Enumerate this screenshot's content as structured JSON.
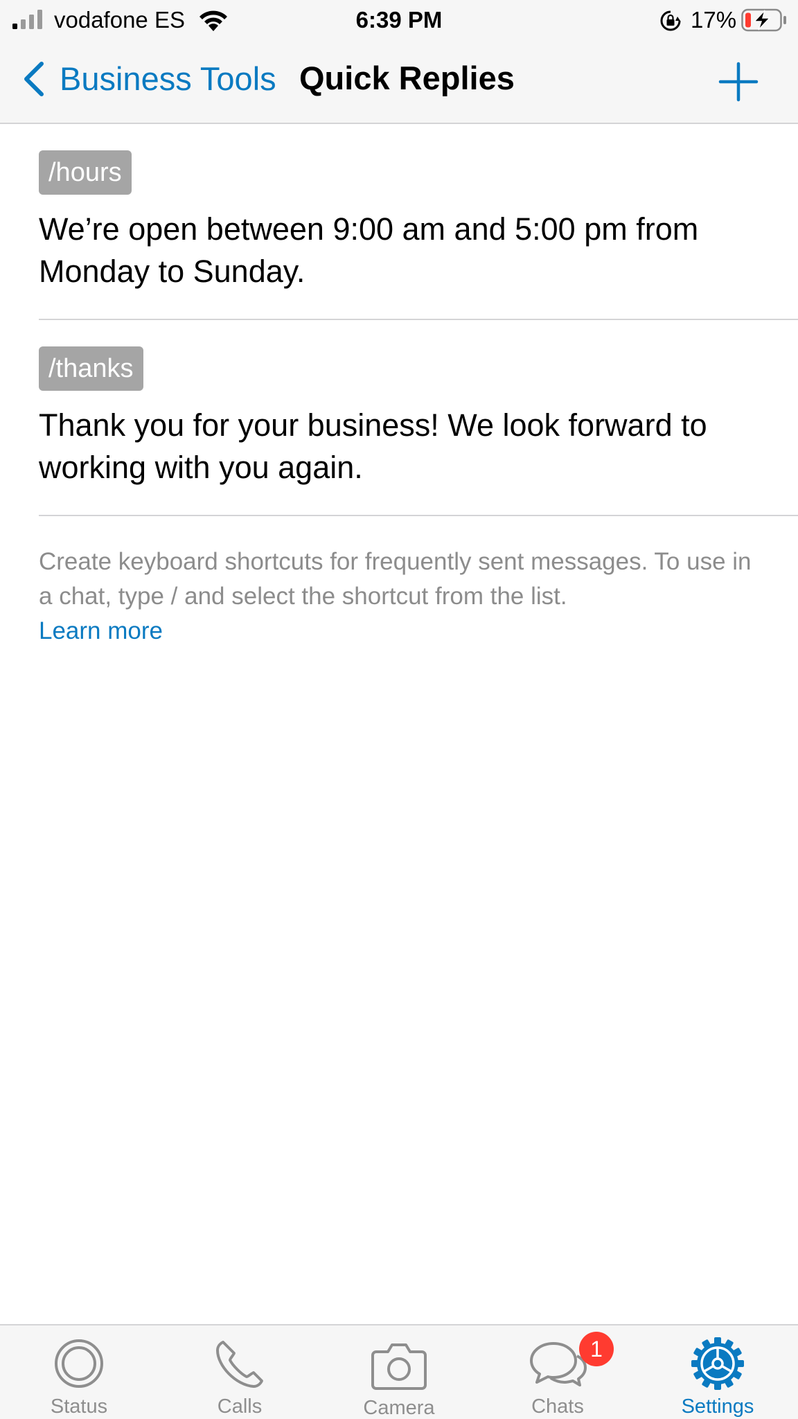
{
  "status_bar": {
    "carrier": "vodafone ES",
    "time": "6:39 PM",
    "battery_percent": "17%",
    "icons": [
      "signal-icon",
      "wifi-icon",
      "lock-rotation-icon",
      "battery-charging-icon"
    ]
  },
  "nav": {
    "back_label": "Business Tools",
    "title": "Quick Replies",
    "add_icon": "plus-icon"
  },
  "quick_replies": [
    {
      "shortcut": "/hours",
      "message": "We’re open between 9:00 am and 5:00 pm from Monday to Sunday."
    },
    {
      "shortcut": "/thanks",
      "message": "Thank you for your business! We look forward to working with you again."
    }
  ],
  "footer": {
    "note": "Create keyboard shortcuts for frequently sent messages. To use in a chat, type / and select the shortcut from the list.",
    "learn_more": "Learn more"
  },
  "tab_bar": {
    "tabs": [
      {
        "label": "Status",
        "icon": "status-icon"
      },
      {
        "label": "Calls",
        "icon": "phone-icon"
      },
      {
        "label": "Camera",
        "icon": "camera-icon"
      },
      {
        "label": "Chats",
        "icon": "chat-bubbles-icon",
        "badge": "1"
      },
      {
        "label": "Settings",
        "icon": "settings-gear-icon",
        "active": true
      }
    ]
  },
  "colors": {
    "accent": "#0a7ac1",
    "badge_bg": "#a5a5a5",
    "notification_badge": "#ff3b30",
    "inactive_tab": "#8e8e8e",
    "battery_low": "#ff3b30"
  }
}
